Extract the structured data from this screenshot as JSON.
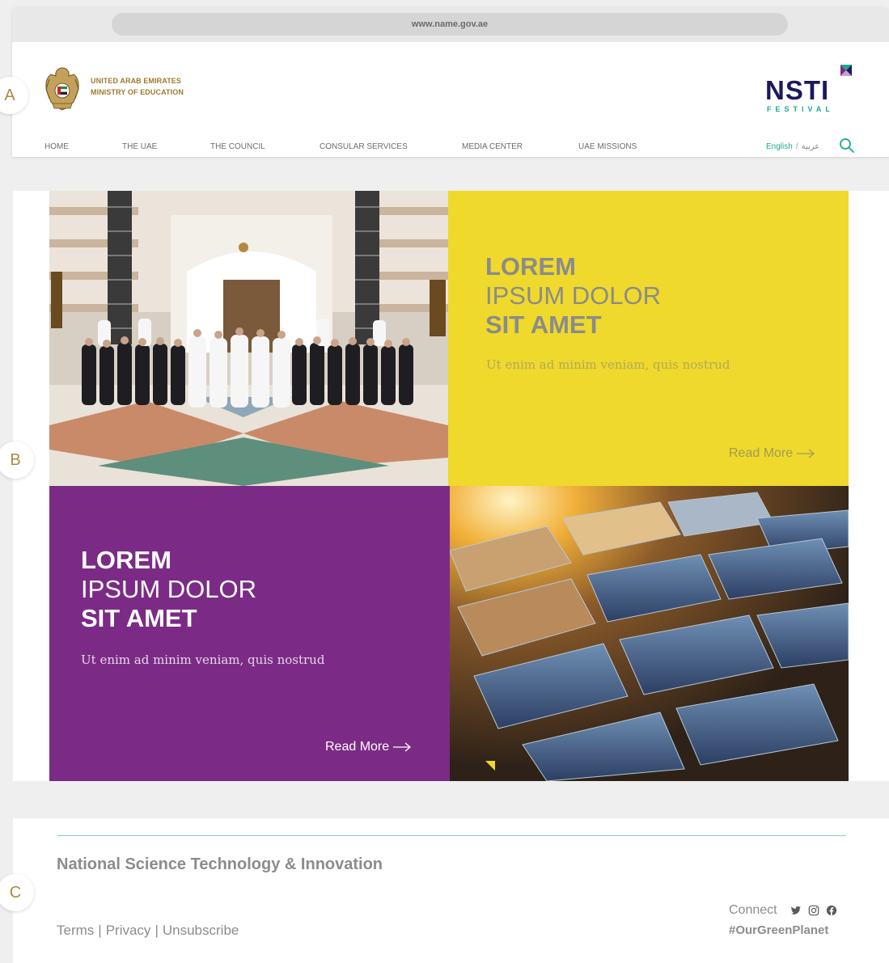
{
  "browser": {
    "url": "www.name.gov.ae"
  },
  "markers": {
    "a": "A",
    "b": "B",
    "c": "C"
  },
  "header": {
    "ministry_line1": "UNITED ARAB EMIRATES",
    "ministry_line2": "MINISTRY OF EDUCATION",
    "logo_word": "NSTI",
    "logo_sub": "FESTIVAL",
    "nav": [
      "HOME",
      "THE UAE",
      "THE COUNCIL",
      "CONSULAR SERVICES",
      "MEDIA CENTER",
      "UAE MISSIONS"
    ],
    "lang_en": "English",
    "lang_sep": "/",
    "lang_ar": "عربية"
  },
  "cards": {
    "yellow": {
      "line1": "LOREM",
      "line2": "IPSUM DOLOR",
      "line3": "SIT AMET",
      "sub": "Ut enim ad minim veniam, quis nostrud",
      "cta": "Read More"
    },
    "purple": {
      "line1": "LOREM",
      "line2": "IPSUM DOLOR",
      "line3": "SIT AMET",
      "sub": "Ut enim ad minim veniam, quis nostrud",
      "cta": "Read More"
    }
  },
  "footer": {
    "title": "National Science Technology & Innovation",
    "links": [
      "Terms",
      "Privacy",
      "Unsubscribe"
    ],
    "separator": "|",
    "connect": "Connect",
    "social_icons": [
      "twitter-icon",
      "instagram-icon",
      "facebook-icon"
    ],
    "hashtag": "#OurGreenPlanet"
  },
  "colors": {
    "accent_teal": "#1aa98e",
    "gold": "#a07a2e",
    "yellow_tile": "#eed92c",
    "purple_tile": "#7b2b85",
    "navy_logo": "#1c1a5a"
  }
}
